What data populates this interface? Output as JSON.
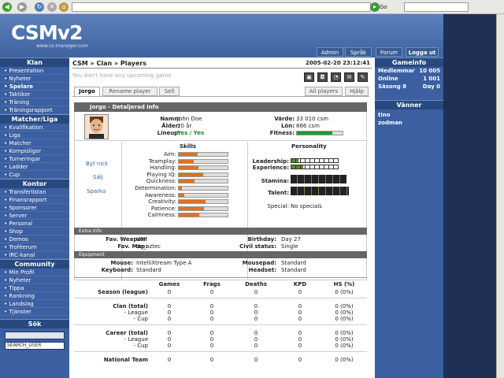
{
  "header": {
    "logo": "CSMv2",
    "subtitle": "www.cs-manager.com",
    "buttons": [
      "Admin",
      "Språk",
      "Forum",
      "Logga ut"
    ]
  },
  "leftnav": {
    "klan": {
      "title": "Klan",
      "items": [
        "Presentation",
        "Nyheter",
        "Spelare",
        "Taktiker",
        "Träning",
        "Träningsrapport"
      ]
    },
    "matcher": {
      "title": "Matcher/Liga",
      "items": [
        "Kvalifikation",
        "Liga",
        "Matcher",
        "Kompisligor",
        "Turneringar",
        "Ladder",
        "Cup"
      ]
    },
    "kontor": {
      "title": "Kontor",
      "items": [
        "Transferlistan",
        "Finansrapport",
        "Sponsorer",
        "Server",
        "Personal",
        "Shop",
        "Demos",
        "Troféerum",
        "IRC-kanal"
      ]
    },
    "community": {
      "title": "Community",
      "items": [
        "Min Profil",
        "Nyheter",
        "Tippa",
        "Rankning",
        "Landslag",
        "Tjänster"
      ]
    },
    "sok": {
      "title": "Sök",
      "select": "SEARCH_USER"
    }
  },
  "rightbar": {
    "gameinfo": {
      "title": "Gameinfo",
      "rows": [
        {
          "label": "Medlemmar",
          "value": "10 005"
        },
        {
          "label": "Online",
          "value": "1 001"
        },
        {
          "label": "Säsong 8",
          "value": "Day 0"
        }
      ]
    },
    "friends": {
      "title": "Vänner",
      "items": [
        "tino",
        "zodman"
      ]
    }
  },
  "main": {
    "breadcrumb": "CSM » Clan » Players",
    "datetime": "2005-02-20 23:12:41",
    "notice": "You don't have any upcoming game",
    "tabs": [
      "Jorgo",
      "Rename player",
      "Sell"
    ],
    "rtabs": [
      "All players",
      "Hjälp"
    ],
    "detail_title": "Jorgo - Detaljerad info",
    "player": {
      "namn_l": "Namn:",
      "namn": "John Doe",
      "alder_l": "Ålder:",
      "alder": "20 år",
      "lineup_l": "Lineup:",
      "lineup": "Yes / Yes",
      "varde_l": "Värde:",
      "varde": "33 010 csm",
      "lon_l": "Lön:",
      "lon": "866 csm",
      "fitness_l": "Fitness:",
      "fitness": 0.78
    },
    "actions": [
      "Byt nick",
      "Sälj",
      "Sparka"
    ],
    "skills_title": "Skills",
    "skills": [
      {
        "label": "Aim:",
        "value": 0.38
      },
      {
        "label": "Teamplay:",
        "value": 0.3
      },
      {
        "label": "Handling:",
        "value": 0.4
      },
      {
        "label": "Playing IQ:",
        "value": 0.5
      },
      {
        "label": "Quickness:",
        "value": 0.32
      },
      {
        "label": "Determination:",
        "value": 0.06
      },
      {
        "label": "Awareness:",
        "value": 0.12
      },
      {
        "label": "Creativity:",
        "value": 0.55
      },
      {
        "label": "Patience:",
        "value": 0.52
      },
      {
        "label": "Calmness:",
        "value": 0.42
      }
    ],
    "personality_title": "Personality",
    "personality": {
      "leadership_l": "Leadership:",
      "leadership": 0.15,
      "experience_l": "Experience:",
      "experience": 0.25,
      "stamina_l": "Stamina:",
      "talent_l": "Talent:",
      "special_l": "Special:",
      "special": "No specials"
    },
    "extra_title": "Extra info",
    "extra": {
      "weapon_l": "Fav. Weapon:",
      "weapon": "USP",
      "map_l": "Fav. Map:",
      "map": "de_aztec",
      "birthday_l": "Birthday:",
      "birthday": "Day 27",
      "civil_l": "Civil status:",
      "civil": "Single"
    },
    "equip_title": "Equipment",
    "equip": {
      "mouse_l": "Mouse:",
      "mouse": "IntelliXtream Type A",
      "keyboard_l": "Keyboard:",
      "keyboard": "Standard",
      "pad_l": "Mousepad:",
      "pad": "Standard",
      "headset_l": "Headset:",
      "headset": "Standard"
    },
    "stats": {
      "headers": [
        "Games",
        "Frags",
        "Deaths",
        "KPD",
        "HS (%)"
      ],
      "rows": [
        {
          "label": "Season (league)",
          "vals": [
            "0",
            "0",
            "0",
            "0",
            "0 (0%)"
          ]
        },
        {
          "label": "Clan (total)",
          "vals": [
            "0",
            "0",
            "0",
            "0",
            "0 (0%)"
          ]
        },
        {
          "label": "- League",
          "vals": [
            "0",
            "0",
            "0",
            "0",
            "0 (0%)"
          ]
        },
        {
          "label": "- Cup",
          "vals": [
            "0",
            "0",
            "0",
            "0",
            "0 (0%)"
          ]
        },
        {
          "label": "Career (total)",
          "vals": [
            "0",
            "0",
            "0",
            "0",
            "0 (0%)"
          ]
        },
        {
          "label": "- League",
          "vals": [
            "0",
            "0",
            "0",
            "0",
            "0 (0%)"
          ]
        },
        {
          "label": "- Cup",
          "vals": [
            "0",
            "0",
            "0",
            "0",
            "0 (0%)"
          ]
        },
        {
          "label": "National Team",
          "vals": [
            "0",
            "0",
            "0",
            "0",
            "0 (0%)"
          ]
        }
      ]
    }
  },
  "browser": {
    "go": "Go"
  }
}
